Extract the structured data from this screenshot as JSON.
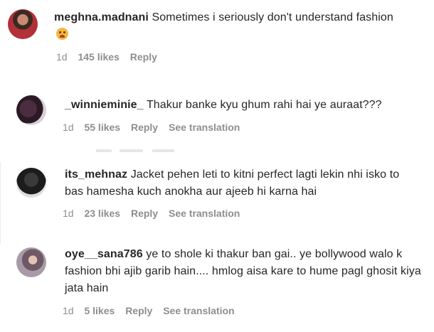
{
  "comments": [
    {
      "username": "meghna.madnani",
      "text": "Sometimes i seriously don't understand fashion",
      "emoji_icon": "thinking-face-emoji",
      "time": "1d",
      "likes": "145 likes",
      "reply": "Reply"
    },
    {
      "username": "_winnieminie_",
      "text": "Thakur banke kyu ghum rahi hai ye auraat???",
      "time": "1d",
      "likes": "55 likes",
      "reply": "Reply",
      "translation": "See translation"
    },
    {
      "username": "its_mehnaz",
      "text": "Jacket pehen leti to kitni perfect lagti lekin nhi isko to bas hamesha kuch anokha aur ajeeb hi karna hai",
      "time": "1d",
      "likes": "23 likes",
      "reply": "Reply",
      "translation": "See translation"
    },
    {
      "username": "oye__sana786",
      "text": "ye to shole ki thakur ban gai.. ye bollywood walo k fashion bhi ajib garib hain.... hmlog aisa kare to hume pagl ghosit kiya jata hain",
      "time": "1d",
      "likes": "5 likes",
      "reply": "Reply",
      "translation": "See translation"
    }
  ],
  "colors": {
    "text": "#262626",
    "meta": "#8e8e8e"
  }
}
